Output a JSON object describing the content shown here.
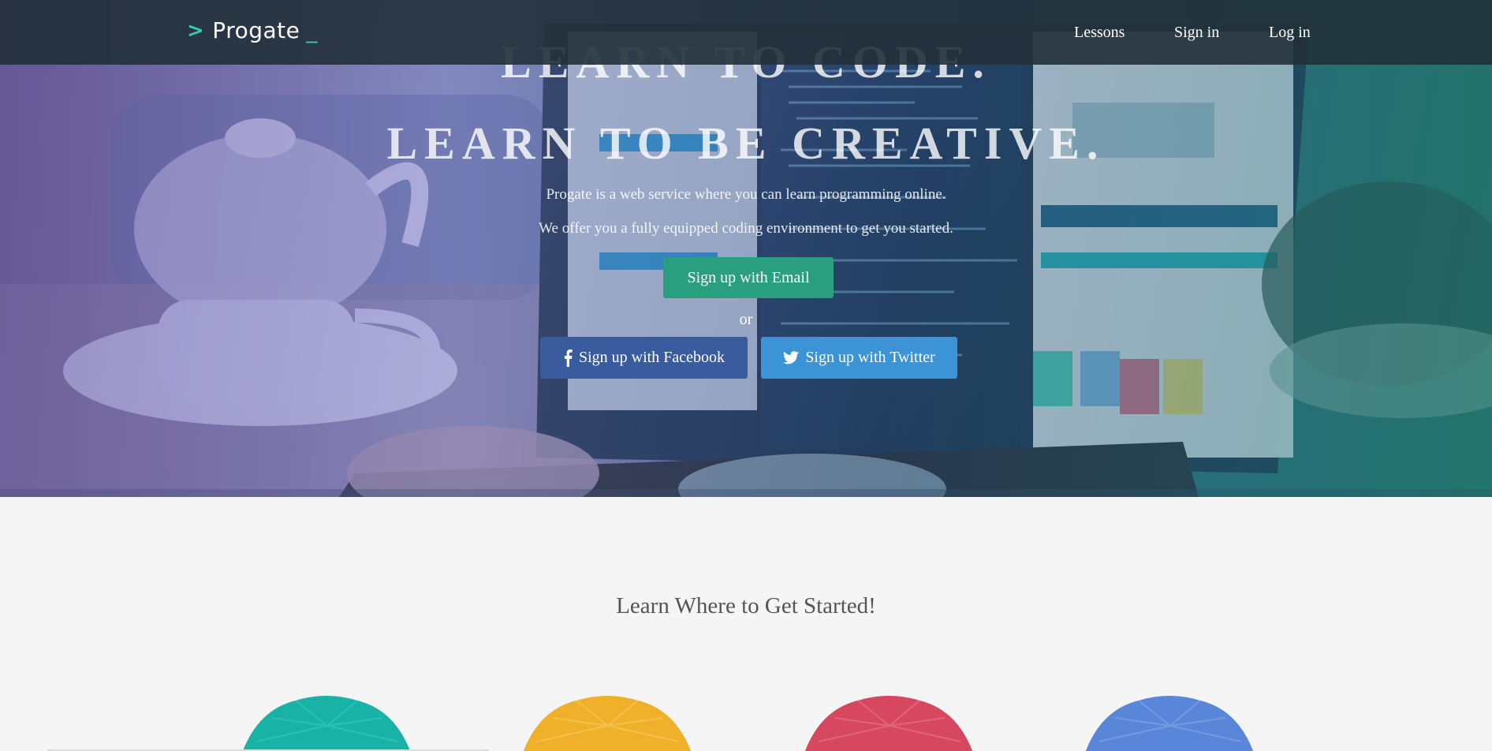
{
  "nav": {
    "logo_chevron": ">",
    "logo_text": "Progate",
    "logo_cursor": "_",
    "links": [
      {
        "label": "Lessons"
      },
      {
        "label": "Sign in"
      },
      {
        "label": "Log in"
      }
    ]
  },
  "hero": {
    "headline1": "Learn to code.",
    "headline2": "Learn to be creative.",
    "desc1": "Progate is a web service where you can learn programming online.",
    "desc2": "We offer you a fully equipped coding environment to get you started.",
    "email_button": "Sign up with Email",
    "or": "or",
    "facebook_button": "Sign up with Facebook",
    "twitter_button": "Sign up with Twitter"
  },
  "section": {
    "title": "Learn Where to Get Started!",
    "gems": [
      {
        "color": "#18b3a6",
        "icon": "teal-course-gem"
      },
      {
        "color": "#efb12a",
        "icon": "yellow-course-gem"
      },
      {
        "color": "#d7475f",
        "icon": "red-course-gem"
      },
      {
        "color": "#5a86d9",
        "icon": "blue-course-gem"
      }
    ]
  },
  "colors": {
    "navbar": "#223038",
    "accent": "#3cc7b0",
    "email_button": "#2a9f80",
    "facebook_button": "#3a5b9e",
    "twitter_button": "#3c94d6"
  }
}
